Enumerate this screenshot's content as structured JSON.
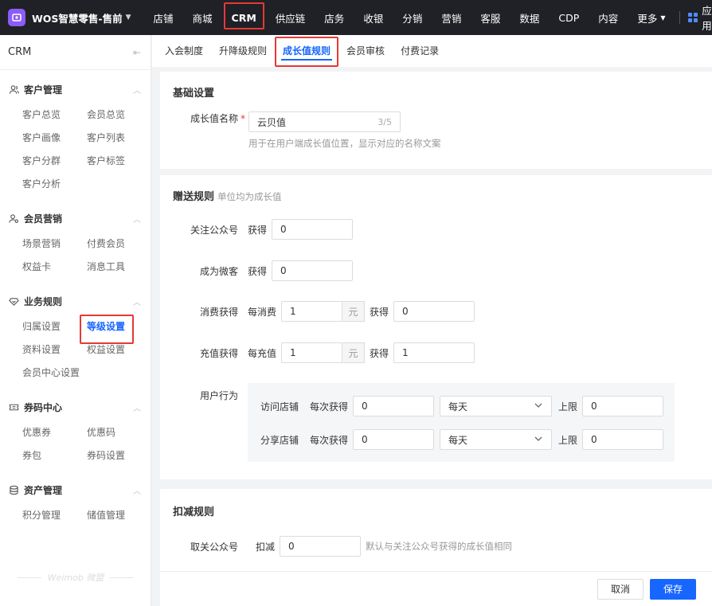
{
  "brand": {
    "name": "WOS智慧零售-售前"
  },
  "nav": {
    "items": [
      "店铺",
      "商城",
      "CRM",
      "供应链",
      "店务",
      "收银",
      "分销",
      "营销",
      "客服",
      "数据",
      "CDP",
      "内容"
    ],
    "more": "更多",
    "apps": "应用"
  },
  "sidebar": {
    "title": "CRM",
    "groups": [
      {
        "label": "客户管理",
        "items": [
          "客户总览",
          "会员总览",
          "客户画像",
          "客户列表",
          "客户分群",
          "客户标签",
          "客户分析"
        ]
      },
      {
        "label": "会员营销",
        "items": [
          "场景营销",
          "付费会员",
          "权益卡",
          "消息工具"
        ]
      },
      {
        "label": "业务规则",
        "items": [
          "归属设置",
          "等级设置",
          "资料设置",
          "权益设置",
          "会员中心设置"
        ]
      },
      {
        "label": "券码中心",
        "items": [
          "优惠券",
          "优惠码",
          "券包",
          "券码设置"
        ]
      },
      {
        "label": "资产管理",
        "items": [
          "积分管理",
          "储值管理"
        ]
      }
    ],
    "footer": "Weimob 微盟"
  },
  "tabs": [
    "入会制度",
    "升降级规则",
    "成长值规则",
    "会员审核",
    "付费记录"
  ],
  "basic": {
    "title": "基础设置",
    "name_label": "成长值名称",
    "name_value": "云贝值",
    "name_count": "3/5",
    "name_hint": "用于在用户端成长值位置，显示对应的名称文案"
  },
  "gift": {
    "title": "赠送规则",
    "subtitle": "单位均为成长值",
    "follow_label": "关注公众号",
    "follow_get": "获得",
    "follow_value": "0",
    "fan_label": "成为微客",
    "fan_get": "获得",
    "fan_value": "0",
    "spend_label": "消费获得",
    "spend_per": "每消费",
    "spend_amount": "1",
    "spend_unit": "元",
    "spend_get": "获得",
    "spend_value": "0",
    "recharge_label": "充值获得",
    "recharge_per": "每充值",
    "recharge_amount": "1",
    "recharge_unit": "元",
    "recharge_get": "获得",
    "recharge_value": "1",
    "behavior_label": "用户行为",
    "visit_label": "访问店铺",
    "visit_each": "每次获得",
    "visit_value": "0",
    "visit_period": "每天",
    "visit_limit_label": "上限",
    "visit_limit": "0",
    "share_label": "分享店铺",
    "share_each": "每次获得",
    "share_value": "0",
    "share_period": "每天",
    "share_limit_label": "上限",
    "share_limit": "0"
  },
  "deduct": {
    "title": "扣减规则",
    "unfollow_label": "取关公众号",
    "unfollow_action": "扣减",
    "unfollow_value": "0",
    "unfollow_hint": "默认与关注公众号获得的成长值相同"
  },
  "footer": {
    "cancel": "取消",
    "save": "保存"
  }
}
